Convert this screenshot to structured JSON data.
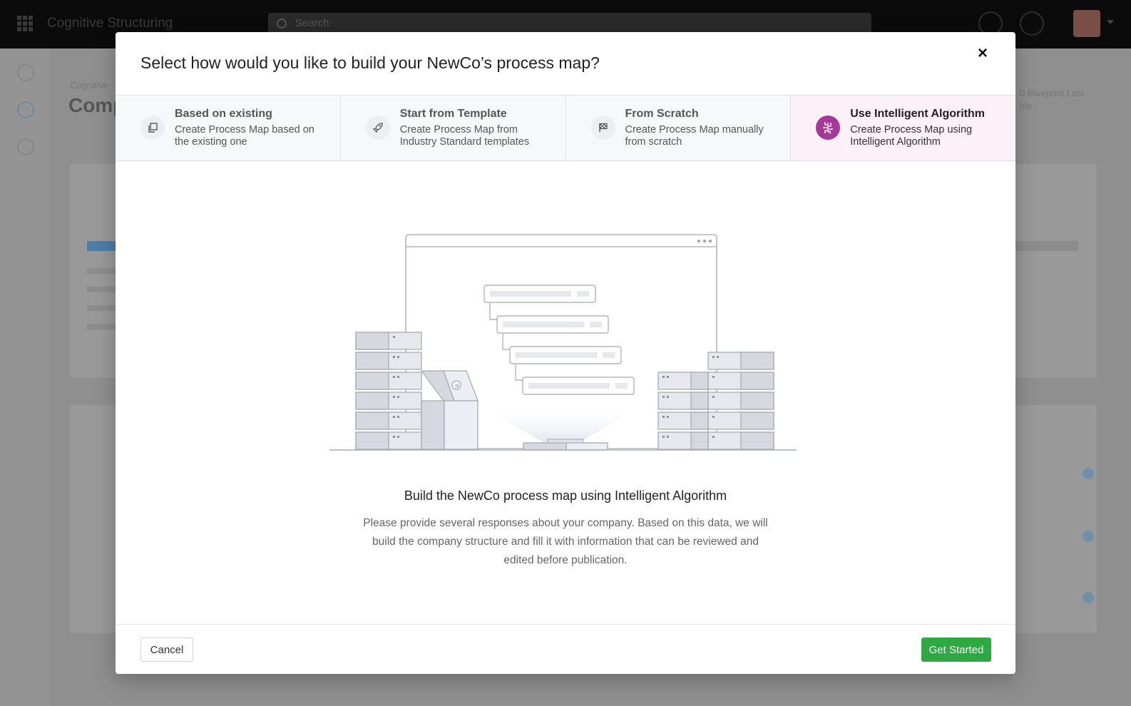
{
  "background": {
    "app_title": "Cognitive Structuring",
    "search_placeholder": "Search",
    "breadcrumb": "Cognitive",
    "page_title": "Comp",
    "right_note_line1": "0 Blueprint Last",
    "right_note_line2": "ble"
  },
  "modal": {
    "title": "Select how would you like to build your NewCo’s process map?",
    "close_label": "×",
    "tabs": [
      {
        "title": "Based on existing",
        "desc": "Create Process Map based on the existing one",
        "icon": "copy-icon"
      },
      {
        "title": "Start from Template",
        "desc": "Create Process Map from Industry Standard templates",
        "icon": "rocket-icon"
      },
      {
        "title": "From Scratch",
        "desc": "Create Process Map manually from scratch",
        "icon": "flag-icon"
      },
      {
        "title": "Use Intelligent Algorithm",
        "desc": "Create Process Map using Intelligent Algorithm",
        "icon": "circuit-icon"
      }
    ],
    "active_tab": 3,
    "body_title": "Build the NewCo process map using Intelligent Algorithm",
    "body_desc": "Please provide several responses about your company. Based on this data, we will build the company structure and fill it with information that can be reviewed and edited before publication.",
    "cancel_label": "Cancel",
    "start_label": "Get Started"
  },
  "colors": {
    "accent": "#a6389a",
    "active_tab_bg": "#fcf0f9",
    "primary_button": "#2ea843"
  }
}
